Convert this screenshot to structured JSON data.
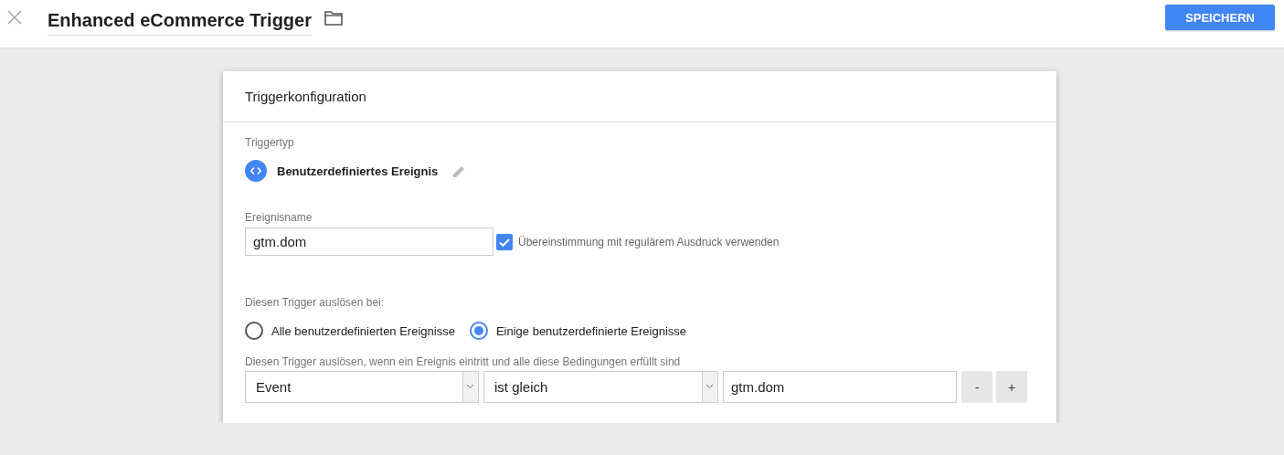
{
  "header": {
    "title": "Enhanced eCommerce Trigger",
    "save_button": "SPEICHERN"
  },
  "card": {
    "title": "Triggerkonfiguration",
    "trigger_type": {
      "label": "Triggertyp",
      "value": "Benutzerdefiniertes Ereignis"
    },
    "event_name": {
      "label": "Ereignisname",
      "value": "gtm.dom"
    },
    "regex_checkbox": {
      "label": "Übereinstimmung mit regulärem Ausdruck verwenden",
      "checked": true
    },
    "fire_on": {
      "label": "Diesen Trigger auslösen bei:",
      "options": [
        {
          "label": "Alle benutzerdefinierten Ereignisse",
          "selected": false
        },
        {
          "label": "Einige benutzerdefinierte Ereignisse",
          "selected": true
        }
      ]
    },
    "conditions": {
      "label": "Diesen Trigger auslösen, wenn ein Ereignis eintritt und alle diese Bedingungen erfüllt sind",
      "row": {
        "variable": "Event",
        "operator": "ist gleich",
        "value": "gtm.dom"
      },
      "buttons": [
        "-",
        "+"
      ]
    }
  }
}
